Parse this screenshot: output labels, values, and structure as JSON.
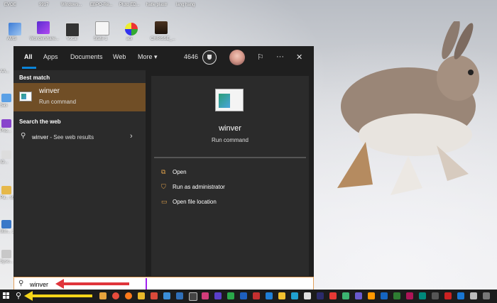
{
  "desktop": {
    "top_labels": [
      "EVOE",
      "9917",
      "Windows...",
      "EBPO-Ré...",
      "Pluto ED...",
      "hatle plastr",
      "lang hang"
    ],
    "icon_labels": [
      "AMS",
      "Wondershare...",
      "Vocal",
      "State 1",
      "aoi",
      "CHRISSE_..."
    ],
    "left_labels": [
      "AA...",
      "Sas",
      "Pho...",
      "IO...",
      "Pa... stati...",
      "Win... 10 U...",
      "Syso..."
    ],
    "colors": {
      "accent": "#0a84d8",
      "best_match_bg": "#704e26",
      "red_arrow": "#e0353b",
      "yellow_arrow": "#f4d419"
    }
  },
  "start_menu": {
    "tabs": [
      "All",
      "Apps",
      "Documents",
      "Web",
      "More"
    ],
    "more_icon": "chevron-down-icon",
    "points": "4646",
    "toolbar_icons": [
      "trophy-icon",
      "avatar",
      "feedback-icon",
      "more-options-icon",
      "close-icon"
    ],
    "best_match_heading": "Best match",
    "best_match": {
      "title": "winver",
      "subtitle": "Run command"
    },
    "web_heading": "Search the web",
    "web_item": {
      "query": "winver",
      "suffix": " - See web results"
    },
    "detail": {
      "title": "winver",
      "subtitle": "Run command",
      "actions": [
        {
          "label": "Open",
          "icon": "open-icon"
        },
        {
          "label": "Run as administrator",
          "icon": "shield-icon"
        },
        {
          "label": "Open file location",
          "icon": "folder-icon"
        }
      ]
    }
  },
  "search": {
    "value": "winver"
  }
}
